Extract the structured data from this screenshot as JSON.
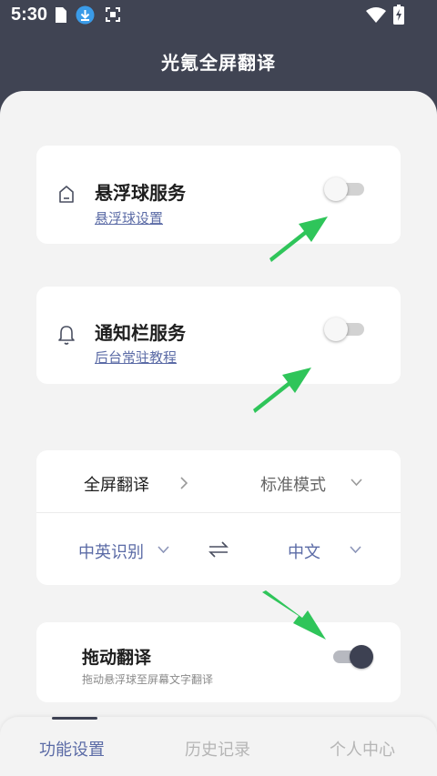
{
  "status_bar": {
    "time": "5:30",
    "icons": [
      "sim-card-icon",
      "download-icon",
      "screenshot-icon",
      "wifi-icon",
      "battery-charging-icon"
    ]
  },
  "header": {
    "title": "光氪全屏翻译"
  },
  "floating_service": {
    "title": "悬浮球服务",
    "link": "悬浮球设置",
    "icon": "floating-ball-icon",
    "enabled": false
  },
  "notification_service": {
    "title": "通知栏服务",
    "link": "后台常驻教程",
    "icon": "bell-icon",
    "enabled": false
  },
  "translate_settings": {
    "mode_label": "全屏翻译",
    "mode_value": "标准模式",
    "source_lang": "中英识别",
    "target_lang": "中文"
  },
  "drag_translate": {
    "title": "拖动翻译",
    "subtitle": "拖动悬浮球至屏幕文字翻译",
    "enabled": true
  },
  "bottom_nav": {
    "items": [
      {
        "label": "功能设置",
        "active": true
      },
      {
        "label": "历史记录",
        "active": false
      },
      {
        "label": "个人中心",
        "active": false
      }
    ]
  },
  "colors": {
    "header_bg": "#404453",
    "accent": "#5b6ba6",
    "arrow_green": "#2fc55a"
  }
}
